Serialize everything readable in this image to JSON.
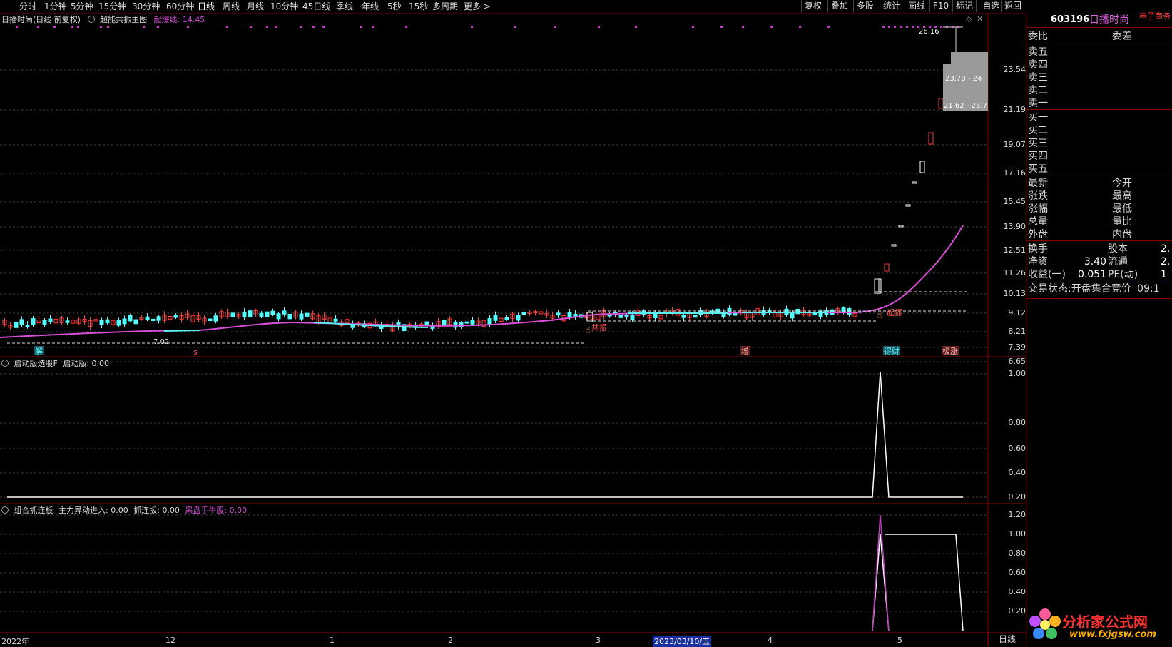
{
  "toolbar": {
    "periods": [
      "分时",
      "1分钟",
      "5分钟",
      "15分钟",
      "30分钟",
      "60分钟",
      "日线",
      "周线",
      "月线",
      "10分钟",
      "45日线",
      "季线",
      "年线",
      "5秒",
      "15秒",
      "多周期",
      "更多 >"
    ],
    "active_period": "日线",
    "buttons": [
      "复权",
      "叠加",
      "多股",
      "统计",
      "画线",
      "F10",
      "标记",
      "-自选",
      "返回"
    ]
  },
  "main_panel": {
    "stock_title": "日播时尚(日线 前复权)",
    "indicator_name": "超能共振主图",
    "indicator_label": "起爆线:",
    "indicator_value": "14.45",
    "price_ticks": [
      "23.54",
      "21.19",
      "19.07",
      "17.16",
      "15.45",
      "13.90",
      "12.51",
      "11.26",
      "10.13",
      "9.12",
      "8.21",
      "7.39",
      "6.65"
    ],
    "annotations": {
      "high_price": "26.16",
      "zone_upper": "23.78 - 24",
      "zone_lower": "21.62 - 23.7",
      "low_mark": "7.02",
      "mark_jie": "解",
      "mark_s": "s",
      "mark_zeng": "增",
      "mark_deng_cai": "得财",
      "mark_zhang": "极涨",
      "mark_gongzhen": "共振",
      "mark_qizhen": "起振"
    }
  },
  "panel2": {
    "name": "启动版选股F",
    "label": "启动版:",
    "value": "0.00",
    "ticks": [
      "1.00",
      "0.80",
      "0.60",
      "0.40",
      "0.20"
    ]
  },
  "panel3": {
    "name": "组合抓连板",
    "label1": "主力异动进入:",
    "value1": "0.00",
    "label2": "抓连扳:",
    "value2": "0.00",
    "label3": "黑盘手牛股:",
    "value3": "0.00",
    "ticks": [
      "1.20",
      "1.00",
      "0.80",
      "0.60",
      "0.40",
      "0.20"
    ]
  },
  "x_axis": {
    "labels": [
      "2022年",
      "12",
      "1",
      "2",
      "3",
      "2023/03/10/五",
      "4",
      "5"
    ],
    "period_label": "日线"
  },
  "right_panel": {
    "code": "603196",
    "name": "日播时尚",
    "sector": "电子商务",
    "weibi": "委比",
    "weicha": "委差",
    "sell_rows": [
      "卖五",
      "卖四",
      "卖三",
      "卖二",
      "卖一"
    ],
    "buy_rows": [
      "买一",
      "买二",
      "买三",
      "买四",
      "买五"
    ],
    "quote_left": [
      "最新",
      "涨跌",
      "涨幅",
      "总量",
      "外盘"
    ],
    "quote_right": [
      "今开",
      "最高",
      "最低",
      "量比",
      "内盘"
    ],
    "fin_left": [
      {
        "label": "换手",
        "value": ""
      },
      {
        "label": "净资",
        "value": "3.40"
      },
      {
        "label": "收益(一)",
        "value": "0.051"
      }
    ],
    "fin_right": [
      {
        "label": "股本",
        "value": "2."
      },
      {
        "label": "流通",
        "value": "2."
      },
      {
        "label": "PE(动)",
        "value": "1"
      }
    ],
    "trade_status_label": "交易状态:",
    "trade_status_value": "开盘集合竞价",
    "trade_time": "09:1"
  },
  "watermark": {
    "title": "分析家公式网",
    "url": "www.fxjgsw.com"
  },
  "colors": {
    "up": "#ff3c3c",
    "down": "#54ffff",
    "magenta_line": "#e040e0",
    "accent_red_border": "#8a0000",
    "white_line": "#ffffff"
  }
}
